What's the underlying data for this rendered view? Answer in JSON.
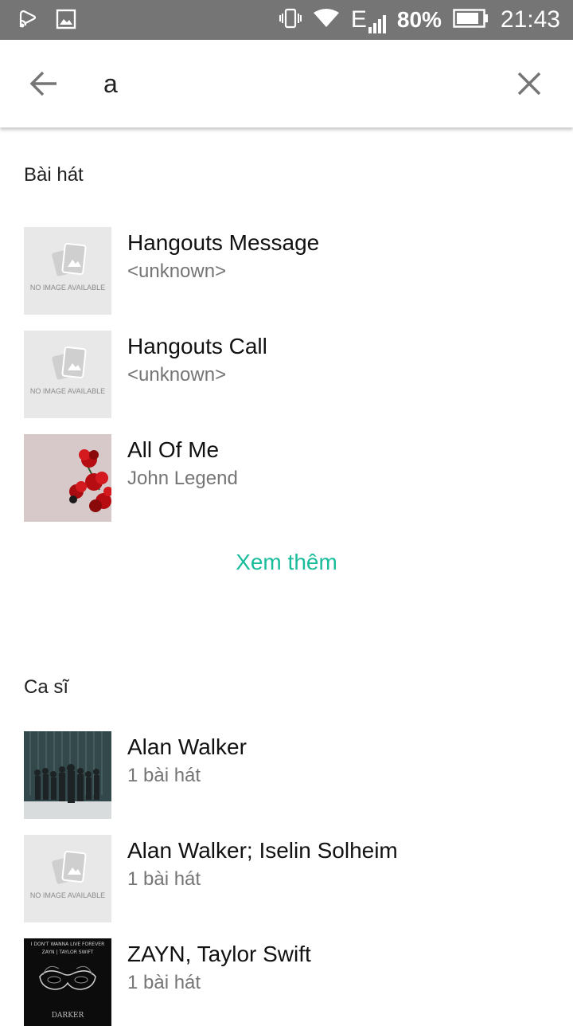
{
  "status_bar": {
    "battery": "80%",
    "time": "21:43",
    "network": "E",
    "icons": [
      "cast-icon",
      "image-icon",
      "vibrate-icon",
      "wifi-icon",
      "signal-icon",
      "battery-icon"
    ]
  },
  "search": {
    "query": "a",
    "back_icon": "arrow-left-icon",
    "clear_icon": "close-icon"
  },
  "songs": {
    "header": "Bài hát",
    "items": [
      {
        "title": "Hangouts Message",
        "subtitle": "<unknown>",
        "art": "no-image",
        "no_image_text": "NO IMAGE AVAILABLE"
      },
      {
        "title": "Hangouts Call",
        "subtitle": "<unknown>",
        "art": "no-image",
        "no_image_text": "NO IMAGE AVAILABLE"
      },
      {
        "title": "All Of Me",
        "subtitle": "John Legend",
        "art": "red-flowers"
      }
    ],
    "see_more": "Xem thêm"
  },
  "artists": {
    "header": "Ca sĩ",
    "items": [
      {
        "title": "Alan Walker",
        "subtitle": "1 bài hát",
        "art": "alan-walker-cover"
      },
      {
        "title": "Alan Walker; Iselin Solheim",
        "subtitle": "1 bài hát",
        "art": "no-image",
        "no_image_text": "NO IMAGE AVAILABLE"
      },
      {
        "title": "ZAYN, Taylor Swift",
        "subtitle": "1 bài hát",
        "art": "mask-cover",
        "cover_text": [
          "I DON'T WANNA LIVE FOREVER",
          "ZAYN | TAYLOR SWIFT",
          "DARKER"
        ]
      }
    ]
  },
  "colors": {
    "status_bar_bg": "#757575",
    "accent": "#1abc9c",
    "secondary_text": "#757575"
  }
}
